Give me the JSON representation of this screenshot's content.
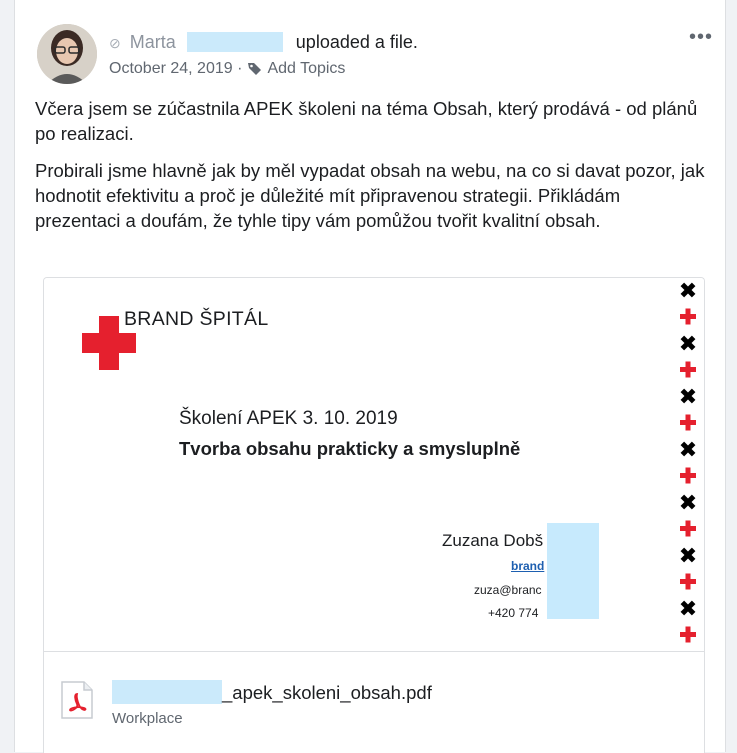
{
  "post": {
    "author": "Marta",
    "action": "uploaded a file.",
    "date": "October 24, 2019",
    "separator": "·",
    "topics_label": "Add Topics",
    "more_label": "•••",
    "paragraphs": [
      "Včera jsem se zúčastnila APEK školeni na téma Obsah, který prodává - od plánů po realizaci.",
      "Probirali jsme hlavně jak by měl vypadat obsah na webu, na co si davat pozor, jak hodnotit efektivitu a proč je důležité mít připravenou strategii. Přikládám prezentaci a doufám, že tyhle tipy vám pomůžou tvořit kvalitní obsah."
    ]
  },
  "attachment": {
    "slide": {
      "brand": "BRAND ŠPITÁL",
      "date_line": "Školení APEK 3. 10. 2019",
      "title": "Tvorba obsahu prakticky a smysluplně",
      "contact_name": "Zuzana Dobš",
      "contact_link": "brand",
      "contact_email": "zuza@branc",
      "contact_phone": "+420 774",
      "accent_red": "#e5202e",
      "pattern_colors": [
        "#000000",
        "#e5202e"
      ]
    },
    "file_name_suffix": "_apek_skoleni_obsah.pdf",
    "source": "Workplace",
    "icon": "pdf-icon"
  }
}
